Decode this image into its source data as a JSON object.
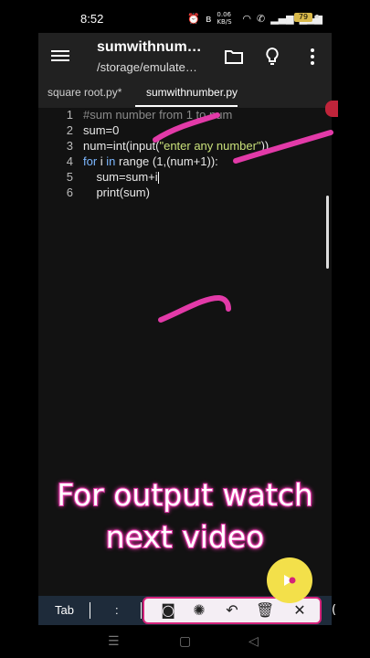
{
  "status": {
    "time": "8:52",
    "net_speed": "0.06 KB/S",
    "battery": "79"
  },
  "appbar": {
    "title": "sumwithnum…",
    "subtitle": "/storage/emulate…"
  },
  "tabs": [
    {
      "label": "square root.py*"
    },
    {
      "label": "sumwithnumber.py"
    }
  ],
  "code": {
    "line_numbers": [
      "1",
      "2",
      "3",
      "4",
      "5",
      "6"
    ],
    "l1": "#sum number from 1 to num",
    "l2": "sum=0",
    "l3a": "num=int(input(",
    "l3b": "\"enter any number\"",
    "l3c": "))",
    "l4a": "for",
    "l4b": " i ",
    "l4c": "in",
    "l4d": " range (1,(num+1)):",
    "l5": "    sum=sum+i",
    "l6": "    print(sum)"
  },
  "keybar": {
    "tab": "Tab",
    "colon": ":",
    "paren": "("
  },
  "overlay": {
    "line1": "For output watch",
    "line2": "next video"
  },
  "colors": {
    "annotation": "#e23aa8",
    "keyword": "#7cb7ff",
    "appbar": "#212121"
  }
}
